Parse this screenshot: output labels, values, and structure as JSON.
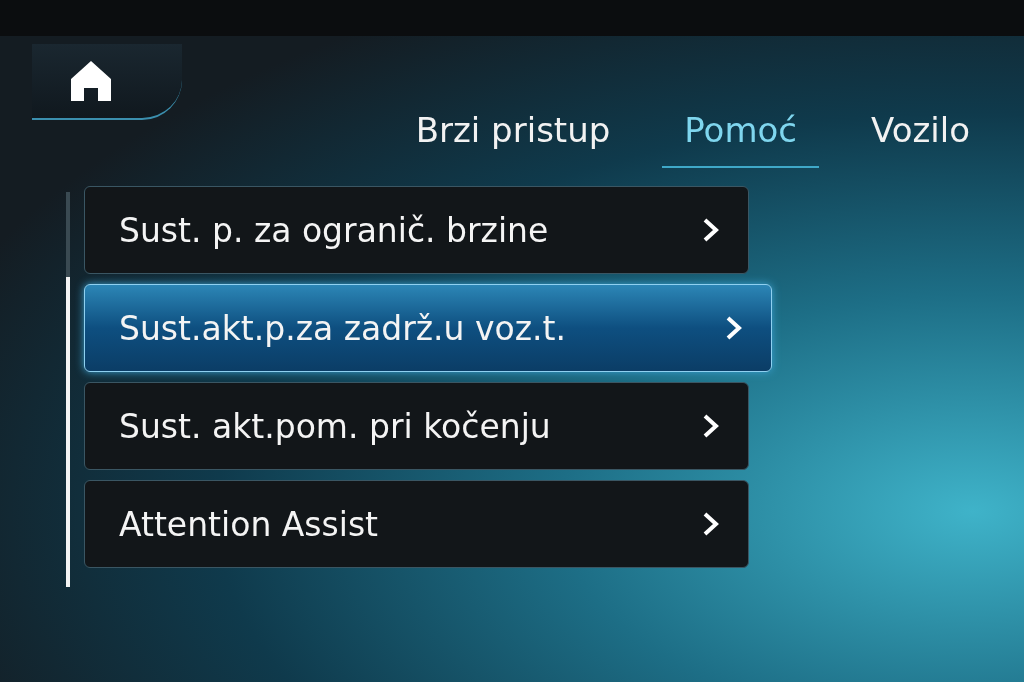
{
  "tabs": [
    {
      "label": "Brzi pristup",
      "selected": false
    },
    {
      "label": "Pomoć",
      "selected": true
    },
    {
      "label": "Vozilo",
      "selected": false
    }
  ],
  "menu_items": [
    {
      "label": "Sust. p. za ogranič. brzine",
      "selected": false
    },
    {
      "label": "Sust.akt.p.za zadrž.u voz.t.",
      "selected": true
    },
    {
      "label": "Sust. akt.pom. pri kočenju",
      "selected": false
    },
    {
      "label": "Attention Assist",
      "selected": false
    }
  ]
}
